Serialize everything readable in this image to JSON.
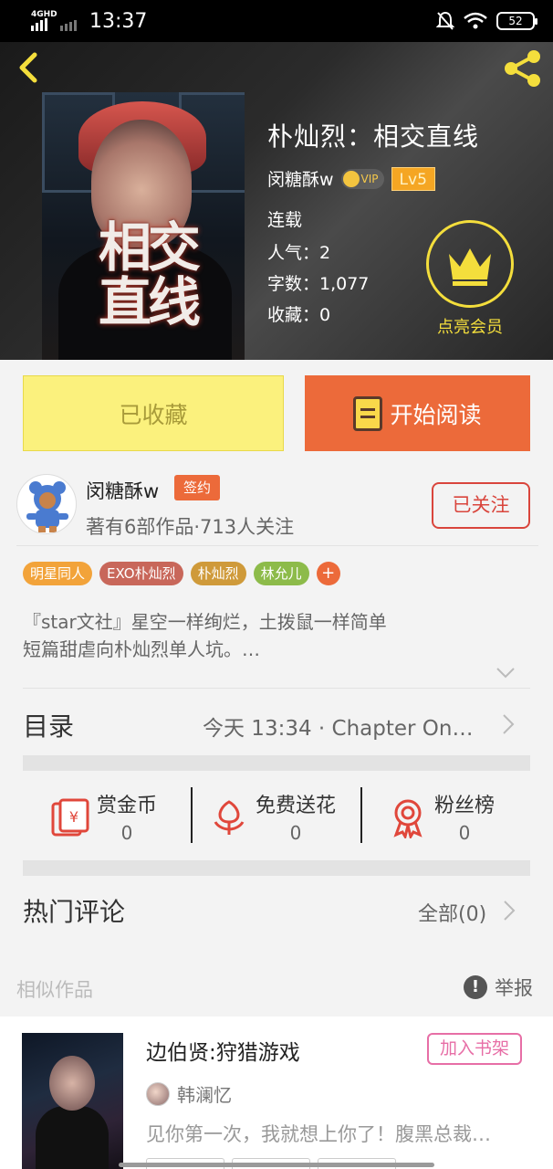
{
  "status_bar": {
    "network": "4GHD",
    "time": "13:37",
    "battery": "52"
  },
  "book": {
    "title": "朴灿烈：相交直线",
    "cover_title": "相交直线",
    "author": "闵糖酥w",
    "vip_label": "VIP",
    "level": "Lv5",
    "status": "连载",
    "popularity": "人气：2",
    "word_count": "字数：1,077",
    "favorites": "收藏：0",
    "membership_label": "点亮会员"
  },
  "actions": {
    "favorited_label": "已收藏",
    "read_label": "开始阅读"
  },
  "author_section": {
    "name": "闵糖酥w",
    "badge": "签约",
    "info": "著有6部作品·713人关注",
    "follow_label": "已关注"
  },
  "tags": [
    {
      "label": "明星同人",
      "color": "#f2a33a"
    },
    {
      "label": "EXO朴灿烈",
      "color": "#c8675a"
    },
    {
      "label": "朴灿烈",
      "color": "#cf9a3a"
    },
    {
      "label": "林允儿",
      "color": "#8dbb4a"
    },
    {
      "label": "+",
      "color": "#ec6a3a"
    }
  ],
  "description": {
    "line1": "『star文社』星空一样绚烂，土拨鼠一样简单",
    "line2": "短篇甜虐向朴灿烈单人坑。…"
  },
  "toc": {
    "label": "目录",
    "latest": "今天 13:34 · Chapter On…"
  },
  "stats": [
    {
      "label": "赏金币",
      "value": "0",
      "icon": "red-envelope-icon"
    },
    {
      "label": "免费送花",
      "value": "0",
      "icon": "flower-icon"
    },
    {
      "label": "粉丝榜",
      "value": "0",
      "icon": "medal-icon"
    }
  ],
  "comments": {
    "label": "热门评论",
    "all_label": "全部(0)"
  },
  "similar": {
    "label": "相似作品",
    "report_label": "举报",
    "items": [
      {
        "title": "边伯贤:狩猎游戏",
        "author": "韩澜忆",
        "description": "见你第一次，我就想上你了！腹黑总裁…",
        "action": "加入书架"
      }
    ]
  },
  "colors": {
    "accent": "#ec6a3a",
    "favorite_bg": "#fbf17d",
    "follow": "#d9453c",
    "gold": "#f4de3c"
  }
}
